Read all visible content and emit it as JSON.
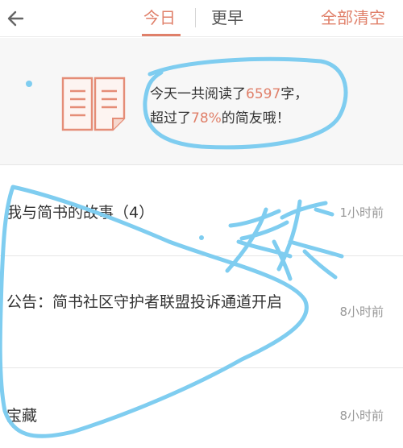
{
  "header": {
    "back_icon": "back-arrow-icon",
    "tabs": [
      {
        "label": "今日",
        "active": true
      },
      {
        "label": "更早",
        "active": false
      }
    ],
    "clear_all": "全部清空",
    "accent_color": "#e0806a"
  },
  "summary": {
    "icon": "open-book-icon",
    "line1_prefix": "今天一共阅读了",
    "words_read": "6597",
    "line1_suffix": "字，",
    "line2_prefix": "超过了",
    "percent": "78%",
    "line2_suffix": "的简友哦！"
  },
  "items": [
    {
      "title": "我与简书的故事（4）",
      "time": "1小时前"
    },
    {
      "title": "公告：简书社区守护者联盟投诉通道开启",
      "time": "8小时前"
    },
    {
      "title": "宝藏",
      "time": "8小时前"
    }
  ],
  "annotation": {
    "color": "#7fcdf0"
  }
}
